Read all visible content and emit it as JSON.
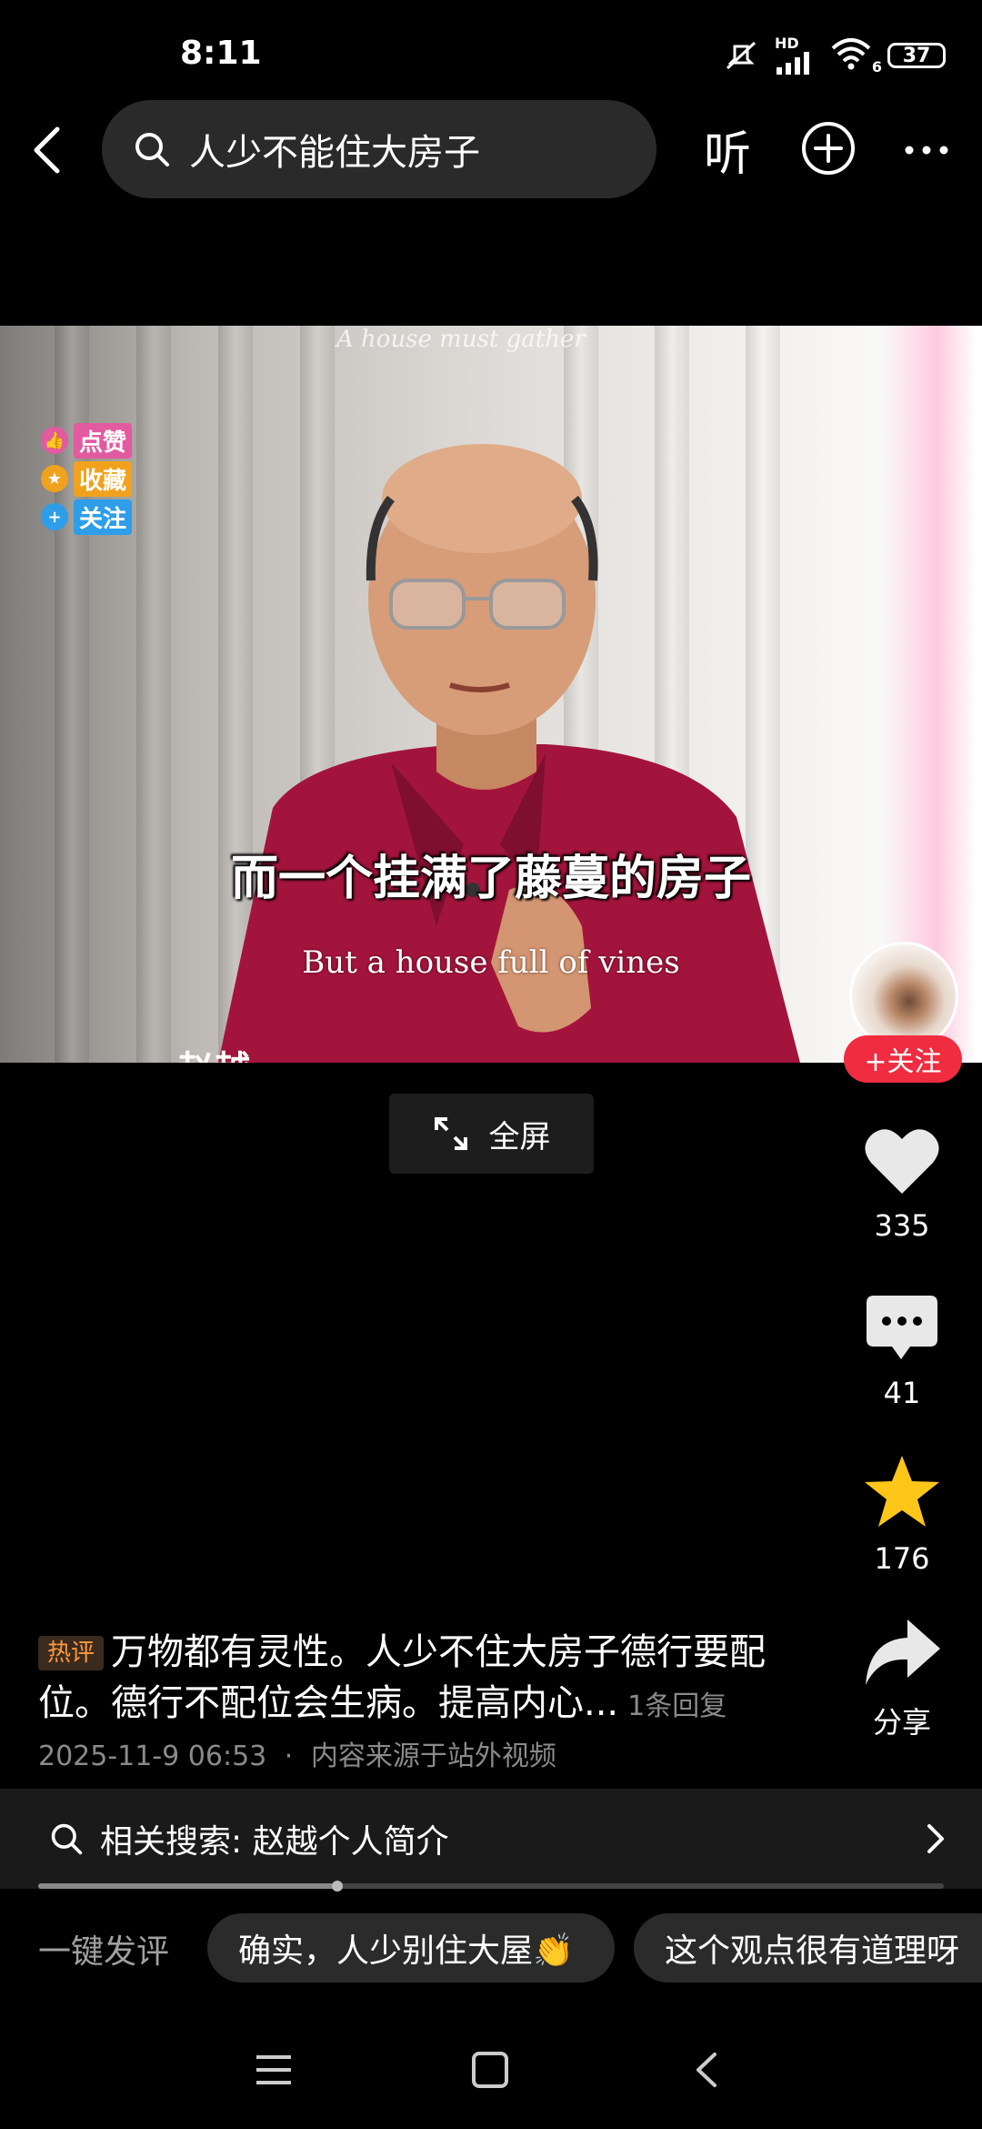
{
  "status": {
    "time": "8:11",
    "network": "HD",
    "wifi_sub": "6",
    "battery": "37"
  },
  "header": {
    "search_query": "人少不能住大房子",
    "listen_label": "听"
  },
  "video": {
    "watermark": "A house must gather",
    "badges": [
      "点赞",
      "收藏",
      "关注"
    ],
    "subtitle_cn": "而一个挂满了藤蔓的房子",
    "subtitle_en": "But a house full of vines",
    "name_fragment": "赵越"
  },
  "fullscreen_label": "全屏",
  "rail": {
    "follow_label": "+关注",
    "likes": "335",
    "comments": "41",
    "favorites": "176",
    "share_label": "分享"
  },
  "hot_comment": {
    "badge": "热评",
    "text": "万物都有灵性。人少不住大房子德行要配位。德行不配位会生病。提高内心...",
    "reply": "1条回复",
    "timestamp": "2025-11-9 06:53",
    "separator": "·",
    "source": "内容来源于站外视频"
  },
  "related_search": {
    "label": "相关搜索: 赵越个人简介",
    "progress": 0.33
  },
  "quick_comment": {
    "label": "一键发评",
    "chips": [
      "确实，人少别住大屋👏",
      "这个观点很有道理呀"
    ]
  },
  "colors": {
    "accent_red": "#f02c40",
    "hot_orange": "#ff9a3d",
    "star_yellow": "#ffc61a"
  }
}
